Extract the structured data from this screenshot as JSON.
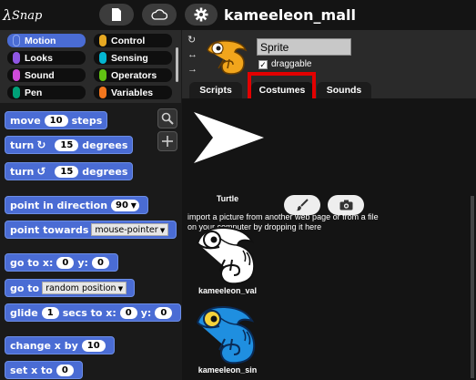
{
  "app": {
    "logo_text": "Snap!"
  },
  "topbar": {
    "project_title": "kameeleon_mall"
  },
  "categories": [
    {
      "label": "Motion",
      "color": "#4a6cd4",
      "selected": true
    },
    {
      "label": "Control",
      "color": "#e6a822",
      "selected": false
    },
    {
      "label": "Looks",
      "color": "#8f56e3",
      "selected": false
    },
    {
      "label": "Sensing",
      "color": "#04b6d2",
      "selected": false
    },
    {
      "label": "Sound",
      "color": "#cf4ad9",
      "selected": false
    },
    {
      "label": "Operators",
      "color": "#62c213",
      "selected": false
    },
    {
      "label": "Pen",
      "color": "#00a178",
      "selected": false
    },
    {
      "label": "Variables",
      "color": "#f3761d",
      "selected": false
    }
  ],
  "blocks": {
    "move": {
      "pre": "move",
      "value": "10",
      "post": "steps"
    },
    "turn_cw": {
      "pre": "turn",
      "value": "15",
      "post": "degrees"
    },
    "turn_ccw": {
      "pre": "turn",
      "value": "15",
      "post": "degrees"
    },
    "point_dir": {
      "pre": "point in direction",
      "value": "90"
    },
    "point_towards": {
      "pre": "point towards",
      "value": "mouse-pointer"
    },
    "goto_xy": {
      "pre": "go to x:",
      "x": "0",
      "mid": "y:",
      "y": "0"
    },
    "goto": {
      "pre": "go to",
      "value": "random position"
    },
    "glide": {
      "pre": "glide",
      "secs": "1",
      "mid1": "secs to x:",
      "x": "0",
      "mid2": "y:",
      "y": "0"
    },
    "change_x": {
      "pre": "change x by",
      "value": "10"
    },
    "set_x": {
      "pre": "set x to",
      "value": "0"
    }
  },
  "sprite": {
    "name": "Sprite",
    "draggable_label": "draggable",
    "draggable": true
  },
  "tabs": [
    {
      "label": "Scripts",
      "active": false
    },
    {
      "label": "Costumes",
      "active": true
    },
    {
      "label": "Sounds",
      "active": false
    }
  ],
  "costumes": {
    "turtle_label": "Turtle",
    "import_text": "import a picture from another web page or from a file on your computer by dropping it here",
    "items": [
      {
        "label": "kameeleon_val",
        "color": "#ffffff"
      },
      {
        "label": "kameeleon_sin",
        "color": "#1f8fe0"
      }
    ]
  },
  "colors": {
    "accent": "#4a6cd4",
    "highlight": "#e30000"
  }
}
